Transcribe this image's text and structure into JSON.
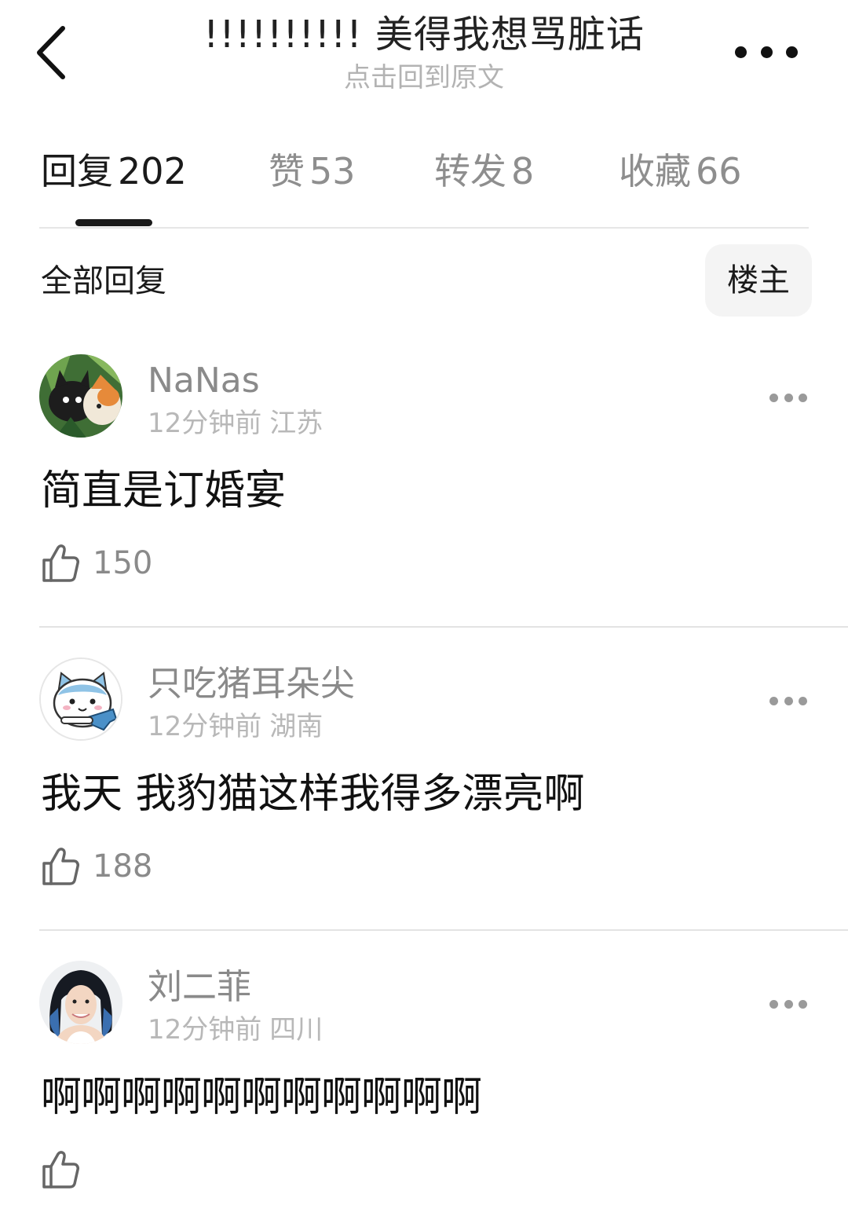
{
  "header": {
    "title": "!!!!!!!!!!  美得我想骂脏话",
    "subtitle": "点击回到原文"
  },
  "tabs": [
    {
      "label": "回复",
      "count": "202",
      "active": true
    },
    {
      "label": "赞",
      "count": "53",
      "active": false
    },
    {
      "label": "转发",
      "count": "8",
      "active": false
    },
    {
      "label": "收藏",
      "count": "66",
      "active": false
    }
  ],
  "filter": {
    "label": "全部回复",
    "button": "楼主"
  },
  "comments": [
    {
      "username": "NaNas",
      "time": "12分钟前",
      "location": "江苏",
      "text": "简直是订婚宴",
      "likes": "150",
      "avatar": "cartoon-cats-avatar"
    },
    {
      "username": "只吃猪耳朵尖",
      "time": "12分钟前",
      "location": "湖南",
      "text": "我天 我豹猫这样我得多漂亮啊",
      "likes": "188",
      "avatar": "cartoon-cat-avatar"
    },
    {
      "username": "刘二菲",
      "time": "12分钟前",
      "location": "四川",
      "text": "啊啊啊啊啊啊啊啊啊啊啊",
      "likes": "",
      "avatar": "portrait-photo-avatar"
    }
  ],
  "colors": {
    "text_primary": "#1a1a1a",
    "text_secondary": "#8a8a8a",
    "text_muted": "#b8b8b8",
    "divider": "#e3e3e3",
    "chip_bg": "#f4f4f4"
  }
}
